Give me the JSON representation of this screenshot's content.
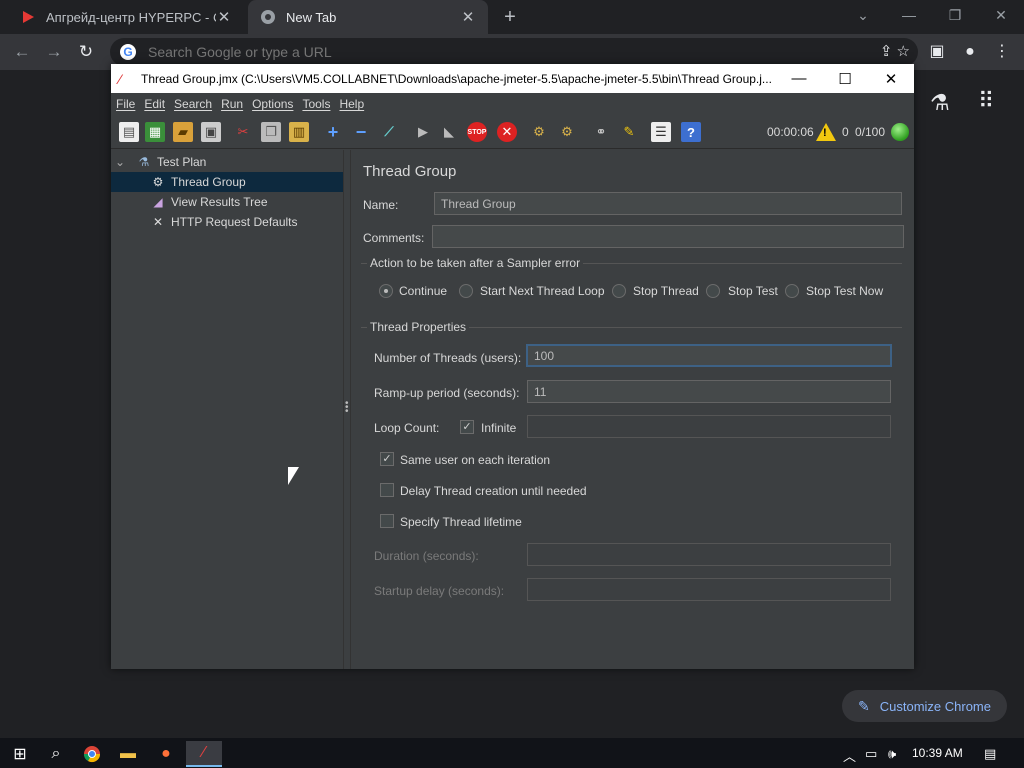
{
  "browser": {
    "tabs": [
      {
        "title": "Апгрейд-центр HYPERPC - С заб",
        "favicon": "youtube-play-icon",
        "active": false
      },
      {
        "title": "New Tab",
        "favicon": "chrome-icon",
        "active": true
      }
    ],
    "omnibox_placeholder": "Search Google or type a URL",
    "customize_label": "Customize Chrome"
  },
  "jmeter": {
    "window_title": "Thread Group.jmx (C:\\Users\\VM5.COLLABNET\\Downloads\\apache-jmeter-5.5\\apache-jmeter-5.5\\bin\\Thread Group.j...",
    "menu": [
      "File",
      "Edit",
      "Search",
      "Run",
      "Options",
      "Tools",
      "Help"
    ],
    "status": {
      "elapsed": "00:00:06",
      "warnings": "0",
      "threads": "0/100"
    },
    "tree": [
      {
        "label": "Test Plan",
        "icon": "flask-icon",
        "level": 0,
        "selected": false
      },
      {
        "label": "Thread Group",
        "icon": "gear-icon",
        "level": 1,
        "selected": true
      },
      {
        "label": "View Results Tree",
        "icon": "chart-icon",
        "level": 1,
        "selected": false
      },
      {
        "label": "HTTP Request Defaults",
        "icon": "wrench-icon",
        "level": 1,
        "selected": false
      }
    ],
    "panel": {
      "title": "Thread Group",
      "name_label": "Name:",
      "name_value": "Thread Group",
      "comments_label": "Comments:",
      "comments_value": "",
      "sampler_error_title": "Action to be taken after a Sampler error",
      "sampler_error_options": [
        "Continue",
        "Start Next Thread Loop",
        "Stop Thread",
        "Stop Test",
        "Stop Test Now"
      ],
      "sampler_error_selected": "Continue",
      "thread_props_title": "Thread Properties",
      "num_threads_label": "Number of Threads (users):",
      "num_threads_value": "100",
      "rampup_label": "Ramp-up period (seconds):",
      "rampup_value": "11",
      "loop_label": "Loop Count:",
      "infinite_label": "Infinite",
      "infinite_checked": true,
      "loop_value": "",
      "same_user_label": "Same user on each iteration",
      "same_user_checked": true,
      "delay_label": "Delay Thread creation until needed",
      "delay_checked": false,
      "lifetime_label": "Specify Thread lifetime",
      "lifetime_checked": false,
      "duration_label": "Duration (seconds):",
      "duration_value": "",
      "startup_label": "Startup delay (seconds):",
      "startup_value": ""
    }
  },
  "taskbar": {
    "time": "10:39 AM"
  }
}
